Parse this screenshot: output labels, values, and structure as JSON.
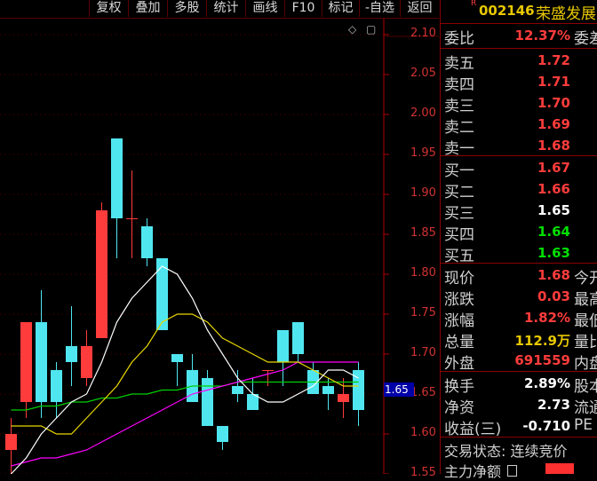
{
  "toolbar": {
    "buttons": [
      "复权",
      "叠加",
      "多股",
      "统计",
      "画线",
      "F10",
      "标记",
      "-自选",
      "返回"
    ]
  },
  "chart": {
    "icons": {
      "diamond": "◇",
      "toggle": "▢"
    },
    "current_price_tag": "1.65",
    "price_ticks": [
      "2.10",
      "2.05",
      "2.00",
      "1.95",
      "1.90",
      "1.85",
      "1.80",
      "1.75",
      "1.70",
      "1.65",
      "1.60",
      "1.55"
    ],
    "colors": {
      "up": "#ff3c3c",
      "down": "#50e6f0",
      "ma5": "#ffffff",
      "ma10": "#e8d800",
      "ma20": "#ff00ff",
      "ma60": "#00d000"
    }
  },
  "chart_data": {
    "type": "candlestick",
    "ylim": [
      1.55,
      2.12
    ],
    "candles": [
      {
        "o": 1.58,
        "h": 1.62,
        "l": 1.55,
        "c": 1.6
      },
      {
        "o": 1.64,
        "h": 1.69,
        "l": 1.62,
        "c": 1.74
      },
      {
        "o": 1.74,
        "h": 1.78,
        "l": 1.62,
        "c": 1.64
      },
      {
        "o": 1.68,
        "h": 1.69,
        "l": 1.62,
        "c": 1.64
      },
      {
        "o": 1.71,
        "h": 1.76,
        "l": 1.66,
        "c": 1.69
      },
      {
        "o": 1.67,
        "h": 1.73,
        "l": 1.66,
        "c": 1.71
      },
      {
        "o": 1.72,
        "h": 1.89,
        "l": 1.72,
        "c": 1.88
      },
      {
        "o": 1.97,
        "h": 1.97,
        "l": 1.82,
        "c": 1.87
      },
      {
        "o": 1.87,
        "h": 1.93,
        "l": 1.82,
        "c": 1.87
      },
      {
        "o": 1.86,
        "h": 1.87,
        "l": 1.81,
        "c": 1.82
      },
      {
        "o": 1.82,
        "h": 1.82,
        "l": 1.73,
        "c": 1.73
      },
      {
        "o": 1.7,
        "h": 1.7,
        "l": 1.66,
        "c": 1.69
      },
      {
        "o": 1.68,
        "h": 1.7,
        "l": 1.65,
        "c": 1.64
      },
      {
        "o": 1.67,
        "h": 1.68,
        "l": 1.61,
        "c": 1.61
      },
      {
        "o": 1.61,
        "h": 1.61,
        "l": 1.58,
        "c": 1.59
      },
      {
        "o": 1.66,
        "h": 1.68,
        "l": 1.64,
        "c": 1.65
      },
      {
        "o": 1.65,
        "h": 1.67,
        "l": 1.63,
        "c": 1.63
      },
      {
        "o": 1.68,
        "h": 1.68,
        "l": 1.66,
        "c": 1.68
      },
      {
        "o": 1.73,
        "h": 1.73,
        "l": 1.66,
        "c": 1.69
      },
      {
        "o": 1.74,
        "h": 1.74,
        "l": 1.69,
        "c": 1.7
      },
      {
        "o": 1.68,
        "h": 1.69,
        "l": 1.65,
        "c": 1.65
      },
      {
        "o": 1.66,
        "h": 1.67,
        "l": 1.63,
        "c": 1.65
      },
      {
        "o": 1.64,
        "h": 1.67,
        "l": 1.62,
        "c": 1.65
      },
      {
        "o": 1.68,
        "h": 1.69,
        "l": 1.61,
        "c": 1.63
      }
    ],
    "ma5": [
      1.55,
      1.57,
      1.6,
      1.62,
      1.64,
      1.65,
      1.69,
      1.74,
      1.77,
      1.79,
      1.81,
      1.8,
      1.77,
      1.73,
      1.7,
      1.67,
      1.65,
      1.64,
      1.64,
      1.65,
      1.66,
      1.68,
      1.68,
      1.67
    ],
    "ma10": [
      1.61,
      1.61,
      1.61,
      1.6,
      1.6,
      1.62,
      1.64,
      1.66,
      1.69,
      1.71,
      1.74,
      1.75,
      1.75,
      1.74,
      1.72,
      1.71,
      1.7,
      1.69,
      1.69,
      1.69,
      1.68,
      1.67,
      1.66,
      1.66
    ],
    "ma20": [
      1.56,
      1.565,
      1.57,
      1.57,
      1.575,
      1.58,
      1.59,
      1.6,
      1.61,
      1.62,
      1.63,
      1.64,
      1.65,
      1.655,
      1.66,
      1.665,
      1.67,
      1.675,
      1.68,
      1.69,
      1.69,
      1.69,
      1.69,
      1.69
    ],
    "ma60": [
      1.63,
      1.63,
      1.635,
      1.635,
      1.64,
      1.64,
      1.645,
      1.645,
      1.65,
      1.65,
      1.655,
      1.655,
      1.66,
      1.66,
      1.66,
      1.665,
      1.665,
      1.665,
      1.665,
      1.665,
      1.665,
      1.665,
      1.665,
      1.665
    ]
  },
  "quote": {
    "tag": "R",
    "code": "002146",
    "name": "荣盛发展",
    "weibi": {
      "label": "委比",
      "value": "12.37%",
      "next": "委差"
    },
    "asks": [
      {
        "label": "卖五",
        "price": "1.72",
        "color": "red"
      },
      {
        "label": "卖四",
        "price": "1.71",
        "color": "red"
      },
      {
        "label": "卖三",
        "price": "1.70",
        "color": "red"
      },
      {
        "label": "卖二",
        "price": "1.69",
        "color": "red"
      },
      {
        "label": "卖一",
        "price": "1.68",
        "color": "red"
      }
    ],
    "bids": [
      {
        "label": "买一",
        "price": "1.67",
        "color": "red"
      },
      {
        "label": "买二",
        "price": "1.66",
        "color": "red"
      },
      {
        "label": "买三",
        "price": "1.65",
        "color": "white"
      },
      {
        "label": "买四",
        "price": "1.64",
        "color": "green"
      },
      {
        "label": "买五",
        "price": "1.63",
        "color": "green"
      }
    ],
    "stats": [
      {
        "label": "现价",
        "value": "1.68",
        "color": "red",
        "right": "今开"
      },
      {
        "label": "涨跌",
        "value": "0.03",
        "color": "red",
        "right": "最高"
      },
      {
        "label": "涨幅",
        "value": "1.82%",
        "color": "red",
        "right": "最低"
      },
      {
        "label": "总量",
        "value": "112.9万",
        "color": "yellow",
        "right": "量比"
      },
      {
        "label": "外盘",
        "value": "691559",
        "color": "red",
        "right": "内盘"
      }
    ],
    "stats2": [
      {
        "label": "换手",
        "value": "2.89%",
        "color": "white",
        "right": "股本"
      },
      {
        "label": "净资",
        "value": "2.73",
        "color": "white",
        "right": "流通"
      },
      {
        "label": "收益(三)",
        "value": "-0.710",
        "color": "white",
        "right": "PE"
      }
    ],
    "trade_status": "交易状态: 连续竞价",
    "main_force": "主力净额"
  }
}
